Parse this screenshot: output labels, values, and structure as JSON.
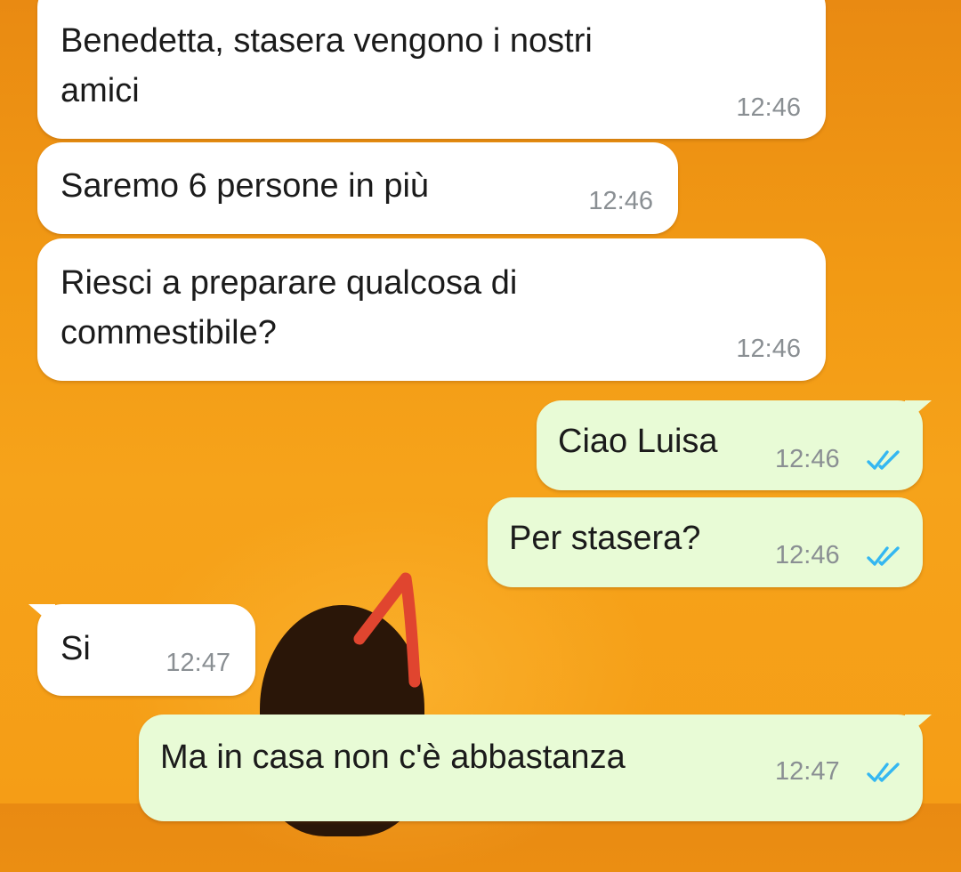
{
  "messages": [
    {
      "direction": "in",
      "lines": [
        "Benedetta, stasera vengono i nostri",
        "amici"
      ],
      "time": "12:46"
    },
    {
      "direction": "in",
      "lines": [
        "Saremo 6 persone in più"
      ],
      "time": "12:46"
    },
    {
      "direction": "in",
      "lines": [
        "Riesci a preparare qualcosa di",
        "commestibile?"
      ],
      "time": "12:46"
    },
    {
      "direction": "out",
      "lines": [
        "Ciao Luisa"
      ],
      "time": "12:46",
      "status": "read"
    },
    {
      "direction": "out",
      "lines": [
        "Per stasera?"
      ],
      "time": "12:46",
      "status": "read"
    },
    {
      "direction": "in",
      "lines": [
        "Si"
      ],
      "time": "12:47"
    },
    {
      "direction": "out",
      "lines": [
        "Ma in casa non c'è abbastanza"
      ],
      "time": "12:47",
      "status": "read"
    }
  ],
  "icons": {
    "read_receipt": "double-check-icon"
  },
  "colors": {
    "incoming_bubble": "#ffffff",
    "outgoing_bubble": "#e8fbd6",
    "read_ticks": "#34b7f1",
    "timestamp": "#8a8f93",
    "wallpaper": "#f29a14",
    "annotation": "#e0452f"
  }
}
